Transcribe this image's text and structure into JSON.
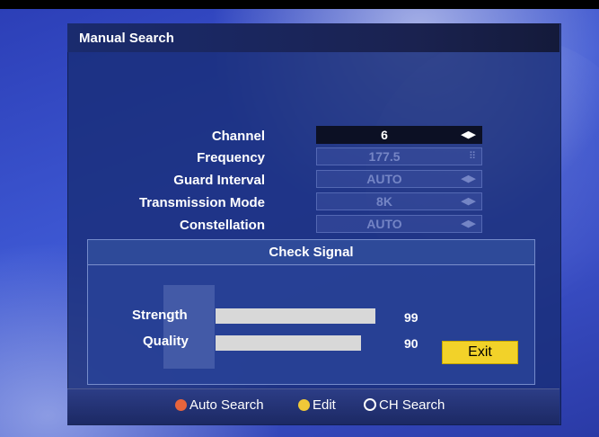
{
  "window": {
    "title": "Manual Search"
  },
  "settings": [
    {
      "label": "Channel",
      "value": "6",
      "icon": "left-right-arrows-icon",
      "active": true
    },
    {
      "label": "Frequency",
      "value": "177.5",
      "icon": "keypad-icon",
      "active": false
    },
    {
      "label": "Guard Interval",
      "value": "AUTO",
      "icon": "left-right-arrows-icon",
      "active": false
    },
    {
      "label": "Transmission Mode",
      "value": "8K",
      "icon": "left-right-arrows-icon",
      "active": false
    },
    {
      "label": "Constellation",
      "value": "AUTO",
      "icon": "left-right-arrows-icon",
      "active": false
    }
  ],
  "dialog": {
    "title": "Check Signal",
    "strength": {
      "label": "Strength",
      "value": "99",
      "level": 99
    },
    "quality": {
      "label": "Quality",
      "value": "90",
      "level": 90
    },
    "exit_label": "Exit"
  },
  "legend": [
    {
      "label": "Auto Search",
      "color": "#e8643c"
    },
    {
      "label": "Edit",
      "color": "#f0c838"
    },
    {
      "label": "CH Search",
      "color": "#ffffff"
    }
  ]
}
